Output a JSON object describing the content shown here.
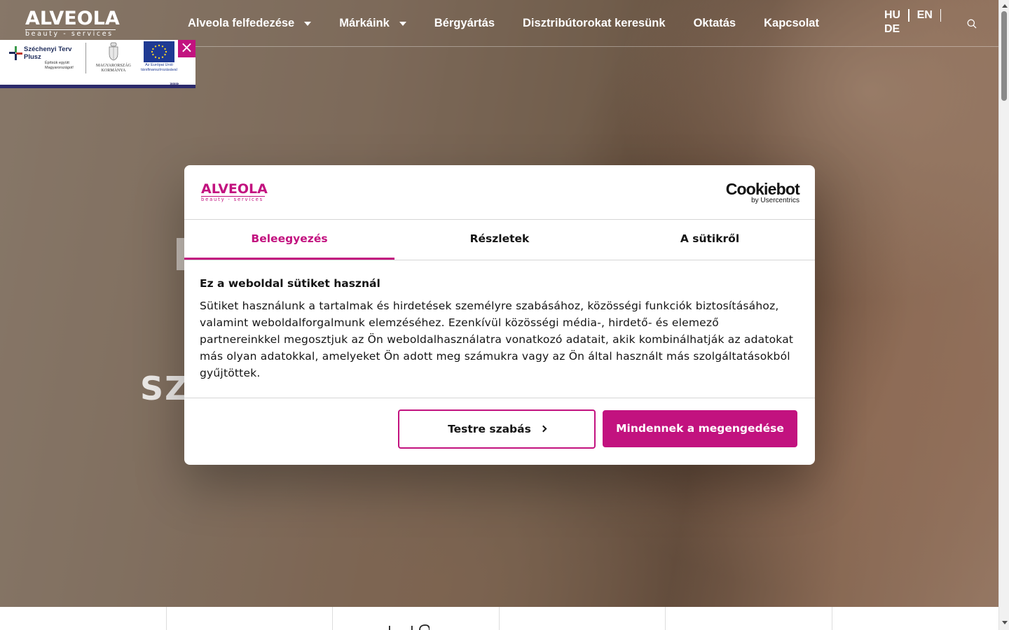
{
  "header": {
    "logo": {
      "main": "ALVEOLA",
      "sub": "beauty - services"
    },
    "nav": [
      {
        "label": "Alveola felfedezése",
        "dropdown": true
      },
      {
        "label": "Márkáink",
        "dropdown": true
      },
      {
        "label": "Bérgyártás",
        "dropdown": false
      },
      {
        "label": "Disztribútorokat keresünk",
        "dropdown": false
      },
      {
        "label": "Oktatás",
        "dropdown": false
      },
      {
        "label": "Kapcsolat",
        "dropdown": false
      }
    ],
    "languages": [
      "HU",
      "EN",
      "DE"
    ],
    "search_icon": "search-icon"
  },
  "eu_badge": {
    "close": "×",
    "szechenyi_title": "Széchenyi Terv Plusz",
    "szechenyi_sub": "Építsük együtt Magyarországot!",
    "government": "MAGYARORSZÁG KORMÁNYA",
    "eu_text": "Az Európai Unió társfinanszírozásával",
    "arrows": "»»»"
  },
  "hero": {
    "fragment_text": "SZO"
  },
  "cookie": {
    "brand_logo": {
      "main": "ALVEOLA",
      "sub": "beauty - services"
    },
    "provider_logo": {
      "main": "Cookiebot",
      "sub": "by Usercentrics"
    },
    "tabs": [
      {
        "label": "Beleegyezés",
        "active": true
      },
      {
        "label": "Részletek",
        "active": false
      },
      {
        "label": "A sütikről",
        "active": false
      }
    ],
    "title": "Ez a weboldal sütiket használ",
    "body": "Sütiket használunk a tartalmak és hirdetések személyre szabásához, közösségi funkciók biztosításához, valamint weboldalforgalmunk elemzéséhez. Ezenkívül közösségi média-, hirdető- és elemező partnereinkkel megosztjuk az Ön weboldalhasználatra vonatkozó adatait, akik kombinálhatják az adatokat más olyan adatokkal, amelyeket Ön adott meg számukra vagy az Ön által használt más szolgáltatásokból gyűjtöttek.",
    "buttons": {
      "customize": "Testre szabás",
      "allow_all": "Mindennek a megengedése"
    }
  },
  "colors": {
    "accent": "#c2127f",
    "text": "#141414",
    "eu_navy": "#2c2a6b",
    "eu_blue": "#1f3a93"
  }
}
